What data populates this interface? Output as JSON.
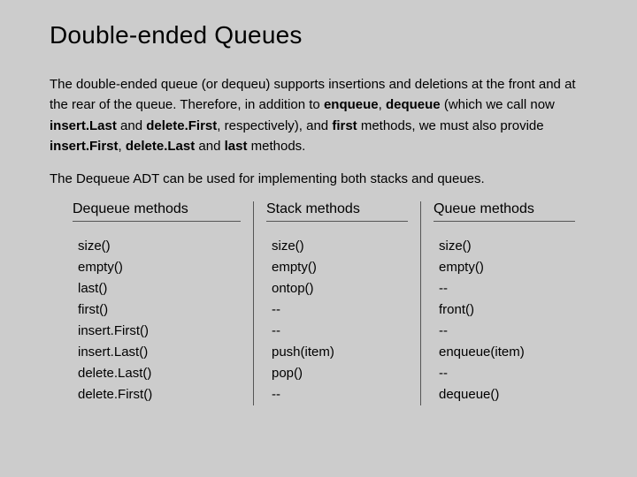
{
  "title": "Double-ended Queues",
  "para1": {
    "t1": "The double-ended queue (or dequeu) supports insertions and deletions at the front and at the rear of the queue. Therefore, in addition to ",
    "b1": "enqueue",
    "t2": ", ",
    "b2": "dequeue",
    "t3": " (which we call now ",
    "b3": "insert.Last",
    "t4": " and ",
    "b4": "delete.First",
    "t5": ", respectively), and ",
    "b5": "first",
    "t6": " methods, we must also provide ",
    "b6": "insert.First",
    "t7": ", ",
    "b7": "delete.Last",
    "t8": " and ",
    "b8": "last",
    "t9": " methods."
  },
  "para2": "The Dequeue ADT can be used for implementing both stacks and queues.",
  "columns": {
    "dequeue": {
      "header": "Dequeue methods",
      "items": [
        "size()",
        "empty()",
        "last()",
        "first()",
        "insert.First()",
        "insert.Last()",
        "delete.Last()",
        "delete.First()"
      ]
    },
    "stack": {
      "header": "Stack methods",
      "items": [
        "size()",
        "empty()",
        "ontop()",
        "--",
        "--",
        "push(item)",
        "pop()",
        "--"
      ]
    },
    "queue": {
      "header": "Queue methods",
      "items": [
        "size()",
        "empty()",
        "--",
        "front()",
        "--",
        "enqueue(item)",
        "--",
        "dequeue()"
      ]
    }
  }
}
